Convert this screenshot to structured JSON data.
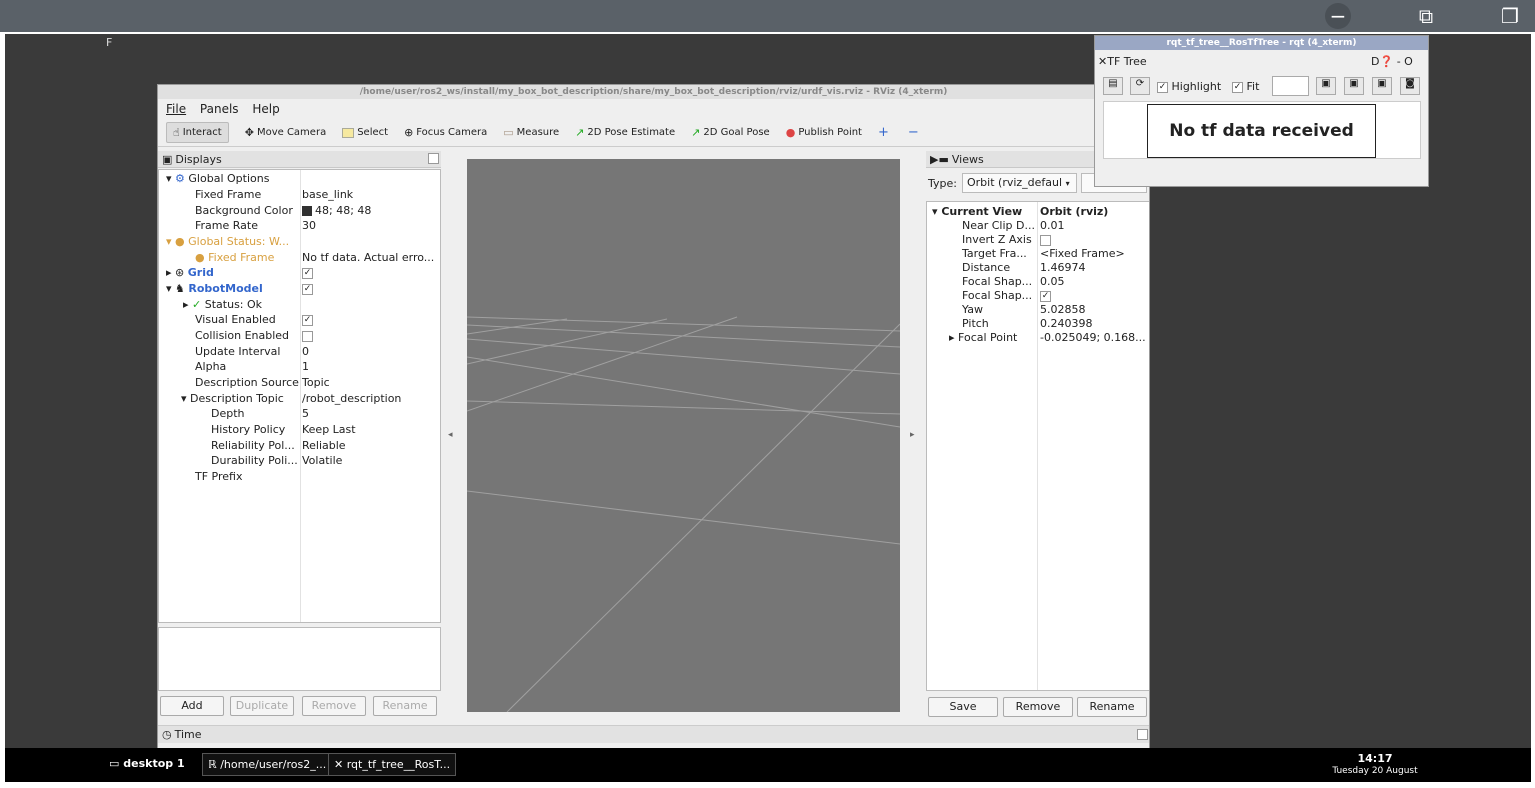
{
  "topbar": {
    "minimize_icon": "minus-icon",
    "popout_icon": "external-link-icon",
    "restore_icon": "restore-window-icon"
  },
  "desktop_char": "F",
  "rviz": {
    "title": "/home/user/ros2_ws/install/my_box_bot_description/share/my_box_bot_description/rviz/urdf_vis.rviz - RViz (4_xterm)",
    "menu": [
      "File",
      "Panels",
      "Help"
    ],
    "tools": [
      "Interact",
      "Move Camera",
      "Select",
      "Focus Camera",
      "Measure",
      "2D Pose Estimate",
      "2D Goal Pose",
      "Publish Point"
    ],
    "displays": {
      "title": "Displays",
      "rows": [
        {
          "k": "Global Options",
          "v": ""
        },
        {
          "k": "Fixed Frame",
          "v": "base_link"
        },
        {
          "k": "Background Color",
          "v": "48; 48; 48"
        },
        {
          "k": "Frame Rate",
          "v": "30"
        },
        {
          "k": "Global Status: W...",
          "v": ""
        },
        {
          "k": "Fixed Frame",
          "v": "No tf data.  Actual erro..."
        },
        {
          "k": "Grid",
          "v": ""
        },
        {
          "k": "RobotModel",
          "v": ""
        },
        {
          "k": "Status: Ok",
          "v": ""
        },
        {
          "k": "Visual Enabled",
          "v": ""
        },
        {
          "k": "Collision Enabled",
          "v": ""
        },
        {
          "k": "Update Interval",
          "v": "0"
        },
        {
          "k": "Alpha",
          "v": "1"
        },
        {
          "k": "Description Source",
          "v": "Topic"
        },
        {
          "k": "Description Topic",
          "v": "/robot_description"
        },
        {
          "k": "Depth",
          "v": "5"
        },
        {
          "k": "History Policy",
          "v": "Keep Last"
        },
        {
          "k": "Reliability Pol...",
          "v": "Reliable"
        },
        {
          "k": "Durability Poli...",
          "v": "Volatile"
        },
        {
          "k": "TF Prefix",
          "v": ""
        }
      ],
      "buttons": [
        "Add",
        "Duplicate",
        "Remove",
        "Rename"
      ]
    },
    "views": {
      "title": "Views",
      "type_label": "Type:",
      "type_value": "Orbit (rviz_defaul",
      "head_k": "Current View",
      "head_v": "Orbit (rviz)",
      "rows": [
        {
          "k": "Near Clip D...",
          "v": "0.01"
        },
        {
          "k": "Invert Z Axis",
          "v": ""
        },
        {
          "k": "Target Fra...",
          "v": "<Fixed Frame>"
        },
        {
          "k": "Distance",
          "v": "1.46974"
        },
        {
          "k": "Focal Shap...",
          "v": "0.05"
        },
        {
          "k": "Focal Shap...",
          "v": ""
        },
        {
          "k": "Yaw",
          "v": "5.02858"
        },
        {
          "k": "Pitch",
          "v": "0.240398"
        },
        {
          "k": "Focal Point",
          "v": "-0.025049; 0.168..."
        }
      ],
      "buttons": [
        "Save",
        "Remove",
        "Rename"
      ]
    },
    "time_label": "Time",
    "bg_color": "#303030"
  },
  "tf": {
    "title": "rqt_tf_tree__RosTfTree - rqt (4_xterm)",
    "header": "TF Tree",
    "right_label": "D",
    "right_extra": "- O",
    "highlight": "Highlight",
    "fit": "Fit",
    "message": "No tf data received"
  },
  "taskbar": {
    "desktop": "desktop 1",
    "item1": "/home/user/ros2_...",
    "item2": "rqt_tf_tree__RosT...",
    "time": "14:17",
    "date": "Tuesday 20 August"
  }
}
